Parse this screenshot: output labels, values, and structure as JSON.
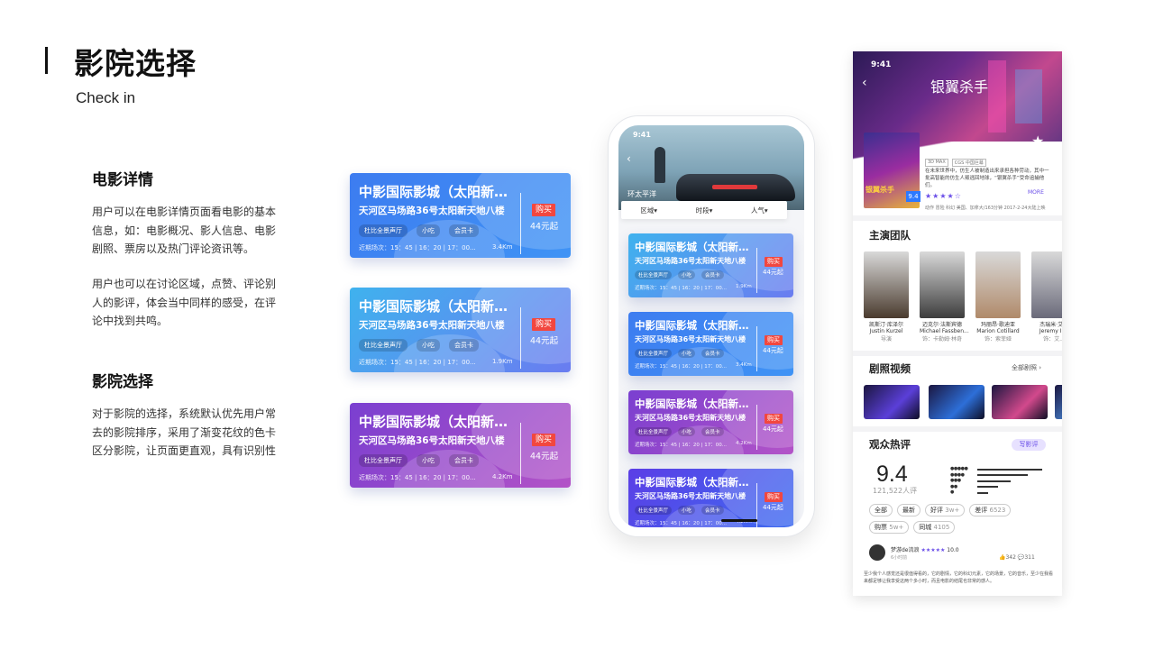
{
  "header": {
    "title": "影院选择",
    "subtitle": "Check in"
  },
  "sections": [
    {
      "title": "电影详情",
      "paragraphs": [
        "用户可以在电影详情页面看电影的基本信息，如：电影概况、影人信息、电影剧照、票房以及热门评论资讯等。",
        "用户也可以在讨论区域，点赞、评论别人的影评，体会当中同样的感受，在评论中找到共鸣。"
      ]
    },
    {
      "title": "影院选择",
      "paragraphs": [
        "对于影院的选择，系统默认优先用户常去的影院排序，采用了渐变花纹的色卡区分影院，让页面更直观，具有识别性"
      ]
    }
  ],
  "cinema_cards": [
    {
      "name": "中影国际影城（太阳新天地店）",
      "address": "天河区马场路36号太阳新天地八楼",
      "tags": [
        "杜比全景声厅",
        "小吃",
        "会员卡"
      ],
      "schedule": "近期场次：15：45 | 16：20 | 17：00...",
      "distance": "3.4Km",
      "buy": "购买",
      "price": "44元起",
      "gradient": [
        "#3d7cf0",
        "#3f93f5"
      ]
    },
    {
      "name": "中影国际影城（太阳新天地店）",
      "address": "天河区马场路36号太阳新天地八楼",
      "tags": [
        "杜比全景声厅",
        "小吃",
        "会员卡"
      ],
      "schedule": "近期场次：15：45 | 16：20 | 17：00...",
      "distance": "1.9Km",
      "buy": "购买",
      "price": "44元起",
      "gradient": [
        "#3fb2ee",
        "#6a7cf0"
      ]
    },
    {
      "name": "中影国际影城（太阳新天地店）",
      "address": "天河区马场路36号太阳新天地八楼",
      "tags": [
        "杜比全景声厅",
        "小吃",
        "会员卡"
      ],
      "schedule": "近期场次：15：45 | 16：20 | 17：00...",
      "distance": "4.2Km",
      "buy": "购买",
      "price": "44元起",
      "gradient": [
        "#7a3fd0",
        "#b353c7"
      ]
    }
  ],
  "phone": {
    "time": "9:41",
    "banner_caption": "环太平洋",
    "filters": [
      "区域▾",
      "时段▾",
      "人气▾"
    ],
    "cards": [
      {
        "name": "中影国际影城（太阳新天地店）",
        "address": "天河区马场路36号太阳新天地八楼",
        "tags": [
          "杜比全景声厅",
          "小吃",
          "会员卡"
        ],
        "schedule": "近期场次：15：45 | 16：20 | 17：00...",
        "distance": "1.9Km",
        "buy": "购买",
        "price": "44元起",
        "gradient": [
          "#3fb2ee",
          "#6a7cf0"
        ]
      },
      {
        "name": "中影国际影城（太阳新天地店）",
        "address": "天河区马场路36号太阳新天地八楼",
        "tags": [
          "杜比全景声厅",
          "小吃",
          "会员卡"
        ],
        "schedule": "近期场次：15：45 | 16：20 | 17：00...",
        "distance": "3.4Km",
        "buy": "购买",
        "price": "44元起",
        "gradient": [
          "#3d7cf0",
          "#3f93f5"
        ]
      },
      {
        "name": "中影国际影城（太阳新天地店）",
        "address": "天河区马场路36号太阳新天地八楼",
        "tags": [
          "杜比全景声厅",
          "小吃",
          "会员卡"
        ],
        "schedule": "近期场次：15：45 | 16：20 | 17：00...",
        "distance": "4.2Km",
        "buy": "购买",
        "price": "44元起",
        "gradient": [
          "#7a3fd0",
          "#b353c7"
        ]
      },
      {
        "name": "中影国际影城（太阳新天地店）",
        "address": "天河区马场路36号太阳新天地八楼",
        "tags": [
          "杜比全景声厅",
          "小吃",
          "会员卡"
        ],
        "schedule": "近期场次：15：45 | 16：20 | 17：00...",
        "distance": "4.2Km",
        "buy": "购买",
        "price": "44元起",
        "gradient": [
          "#5b3ee6",
          "#3d6cf0"
        ]
      }
    ]
  },
  "detail": {
    "time": "9:41",
    "title": "银翼杀手",
    "poster_title": "银翼杀手",
    "score_badge": "9.4",
    "badges": [
      "3D MAX",
      "CGS 中国巨幕"
    ],
    "description": "在未来世界中，仿生人被制造出来承担各种劳动，其中一批高智能的仿生人叛逃回地球，“银翼杀手”受命追捕他们。",
    "stars": "★★★★☆",
    "more": "MORE",
    "meta": "动作 冒险 科幻 美国、加拿大/163分钟 2017-2-24大陆上映",
    "cast_title": "主演团队",
    "cast": [
      {
        "name": "凯斯汀·库泽尔",
        "name_en": "Justin Kurzel",
        "role": "导演",
        "color": "#4a3b2e"
      },
      {
        "name": "迈克尔·法斯宾德",
        "name_en": "Michael Fassben...",
        "role": "饰：卡勒姆·林奇",
        "color": "#3d3d3d"
      },
      {
        "name": "玛丽昂·歌迪亚",
        "name_en": "Marion Cotillard",
        "role": "饰：索菲娅",
        "color": "#b08a6a"
      },
      {
        "name": "杰瑞米·艾...",
        "name_en": "Jeremy Ir...",
        "role": "饰：艾...",
        "color": "#6a6a7a"
      }
    ],
    "videos_title": "剧照视频",
    "videos_all": "全部剧照 ›",
    "videos": [
      {
        "color": "#5b3fd8"
      },
      {
        "color": "#2d6fd8"
      },
      {
        "color": "#d2498c"
      },
      {
        "color": "#4a8ad8"
      }
    ],
    "reviews_title": "观众热评",
    "write_review": "写影评",
    "score": "9.4",
    "rating_count": "121,522人评",
    "rating_dist": [
      {
        "dots": "●●●●●",
        "fill": 0.92
      },
      {
        "dots": "●●●●",
        "fill": 0.72
      },
      {
        "dots": "●●●",
        "fill": 0.48
      },
      {
        "dots": "●●",
        "fill": 0.3
      },
      {
        "dots": "●",
        "fill": 0.15
      }
    ],
    "filters": [
      {
        "label": "全部",
        "count": ""
      },
      {
        "label": "最新",
        "count": ""
      },
      {
        "label": "好评",
        "count": "3w+"
      },
      {
        "label": "差评",
        "count": "6523"
      },
      {
        "label": "购票",
        "count": "5w+"
      },
      {
        "label": "同城",
        "count": "4105"
      }
    ],
    "review": {
      "user": "梦游de流浪",
      "stars": "★★★★★",
      "score": "10.0",
      "time": "6小时前",
      "likes": "👍342",
      "comments": "💬311",
      "text": "至少我个人感觉还是很值得看的，它的剧情，它的科幻元素，它的场景，它的音乐，至少在我看来都足够让我享受这两个多小时，而且电影的结尾也非常的感人。"
    }
  }
}
